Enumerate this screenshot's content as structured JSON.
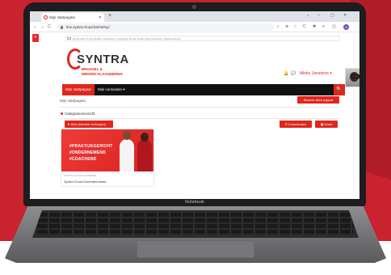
{
  "browser": {
    "tab_title": "Mijn startpagina",
    "tab_close": "✕",
    "new_tab": "+",
    "window_controls": [
      "⌄",
      "–",
      "▢",
      "✕"
    ],
    "nav_back": "←",
    "nav_forward": "→",
    "nav_reload": "C",
    "url": "lms.syntra-cloud.be/mt/my/",
    "extensions": [
      "⌕",
      "⊕",
      "☆",
      "C",
      "✱",
      "≡",
      "◫"
    ],
    "profile_initial": "A"
  },
  "sidebar_toggle": "≡",
  "infobar_text": "Bezig nadat 'Syntra Midden-Vlaanderen' (uitgelogd) als aan andere [Syntra Brussel + Bijgebeurtenis]",
  "site": {
    "logo_main": "SYNTRA",
    "logo_sub": [
      "BRUSSEL &",
      "MIDDEN-VLAANDEREN"
    ],
    "header_icons": [
      "🔔",
      "💬"
    ],
    "user_name": "Mieke Janssens ▾"
  },
  "nav": {
    "active_item": "Mijn startpagina",
    "items": [
      "Mijn cursussen ▾"
    ],
    "search_icon": "🔍"
  },
  "page": {
    "title": "Mijn startpagina",
    "edit_button": "Bewerk deze pagina",
    "category_label": "Categorieoverzicht",
    "filter_button": "▼ Alles (behalve verborgen)",
    "courses_button": "⚲ Cursusnaam",
    "cards_button": "▦ Kaart"
  },
  "card": {
    "hashtags": [
      "#PRAKTIJKGERICHT",
      "#ONDERNEMEND",
      "#COACHEND"
    ],
    "meta": "SYNTRA CLOUD ACADEMIE",
    "title": "Syntra Cloud Docentenruimte"
  },
  "device_label": "Notebook",
  "colors": {
    "brand_red": "#e1261c",
    "navbar": "#111111",
    "background_red": "#c8232f"
  }
}
